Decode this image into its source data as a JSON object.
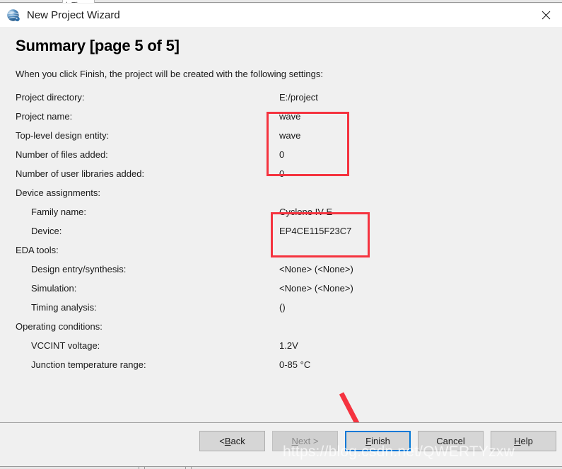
{
  "window": {
    "title": "New Project Wizard",
    "icon": "quartus-globe-icon",
    "close_label": "✕",
    "behind_tab_label": "查看"
  },
  "page": {
    "heading": "Summary [page 5 of 5]",
    "intro": "When you click Finish, the project will be created with the following settings:"
  },
  "summary": [
    {
      "label": "Project directory:",
      "value": "E:/project",
      "indent": false
    },
    {
      "label": "Project name:",
      "value": "wave",
      "indent": false
    },
    {
      "label": "Top-level design entity:",
      "value": "wave",
      "indent": false
    },
    {
      "label": "Number of files added:",
      "value": "0",
      "indent": false
    },
    {
      "label": "Number of user libraries added:",
      "value": "0",
      "indent": false
    },
    {
      "label": "Device assignments:",
      "value": "",
      "indent": false
    },
    {
      "label": "Family name:",
      "value": "Cyclone IV E",
      "indent": true
    },
    {
      "label": "Device:",
      "value": "EP4CE115F23C7",
      "indent": true
    },
    {
      "label": "EDA tools:",
      "value": "",
      "indent": false
    },
    {
      "label": "Design entry/synthesis:",
      "value": "<None> (<None>)",
      "indent": true
    },
    {
      "label": "Simulation:",
      "value": "<None> (<None>)",
      "indent": true
    },
    {
      "label": "Timing analysis:",
      "value": "()",
      "indent": true
    },
    {
      "label": "Operating conditions:",
      "value": "",
      "indent": false
    },
    {
      "label": "VCCINT voltage:",
      "value": "1.2V",
      "indent": true
    },
    {
      "label": "Junction temperature range:",
      "value": "0-85 °C",
      "indent": true
    }
  ],
  "buttons": {
    "back": {
      "pre": "< ",
      "accel": "B",
      "post": "ack",
      "state": "enabled"
    },
    "next": {
      "pre": "",
      "accel": "N",
      "post": "ext >",
      "state": "disabled"
    },
    "finish": {
      "pre": "",
      "accel": "F",
      "post": "inish",
      "state": "focused"
    },
    "cancel": {
      "pre": "",
      "accel": "",
      "post": "Cancel",
      "state": "enabled"
    },
    "help": {
      "pre": "",
      "accel": "H",
      "post": "elp",
      "state": "enabled"
    }
  },
  "annotations": {
    "box_project": "red-highlight-project-values",
    "box_device": "red-highlight-device-values",
    "arrow": "red-arrow-pointing-to-finish",
    "accent_red": "#f5333f",
    "accent_blue": "#0078d7"
  },
  "watermark": "https://blog.csdn.net/QWERTYzxw"
}
